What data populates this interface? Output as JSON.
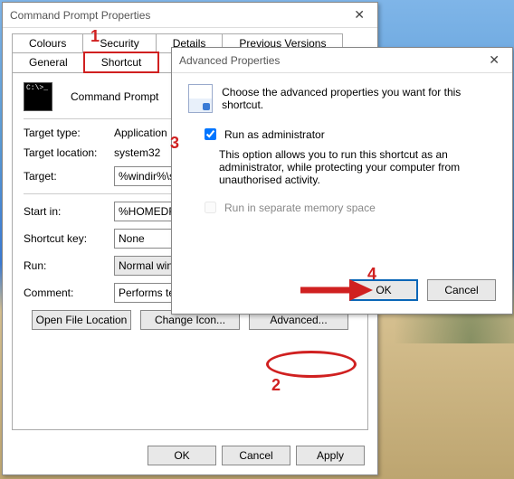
{
  "props_window": {
    "title": "Command Prompt Properties",
    "tabs_top": [
      "Colours",
      "Security",
      "Details",
      "Previous Versions"
    ],
    "tabs_bottom": [
      "General",
      "Shortcut"
    ],
    "active_tab": "Shortcut",
    "header_name": "Command Prompt",
    "fields": {
      "target_type_label": "Target type:",
      "target_type_value": "Application",
      "target_location_label": "Target location:",
      "target_location_value": "system32",
      "target_label": "Target:",
      "target_value": "%windir%\\system",
      "start_in_label": "Start in:",
      "start_in_value": "%HOMEDRIVE%",
      "shortcut_key_label": "Shortcut key:",
      "shortcut_key_value": "None",
      "run_label": "Run:",
      "run_value": "Normal window",
      "comment_label": "Comment:",
      "comment_value": "Performs text-bas"
    },
    "buttons": {
      "open_file_location": "Open File Location",
      "change_icon": "Change Icon...",
      "advanced": "Advanced..."
    },
    "footer": {
      "ok": "OK",
      "cancel": "Cancel",
      "apply": "Apply"
    }
  },
  "adv_dialog": {
    "title": "Advanced Properties",
    "intro": "Choose the advanced properties you want for this shortcut.",
    "run_as_admin_label": "Run as administrator",
    "run_as_admin_desc": "This option allows you to run this shortcut as an administrator, while protecting your computer from unauthorised activity.",
    "sep_mem_label": "Run in separate memory space",
    "ok": "OK",
    "cancel": "Cancel"
  },
  "annotations": {
    "n1": "1",
    "n2": "2",
    "n3": "3",
    "n4": "4"
  }
}
